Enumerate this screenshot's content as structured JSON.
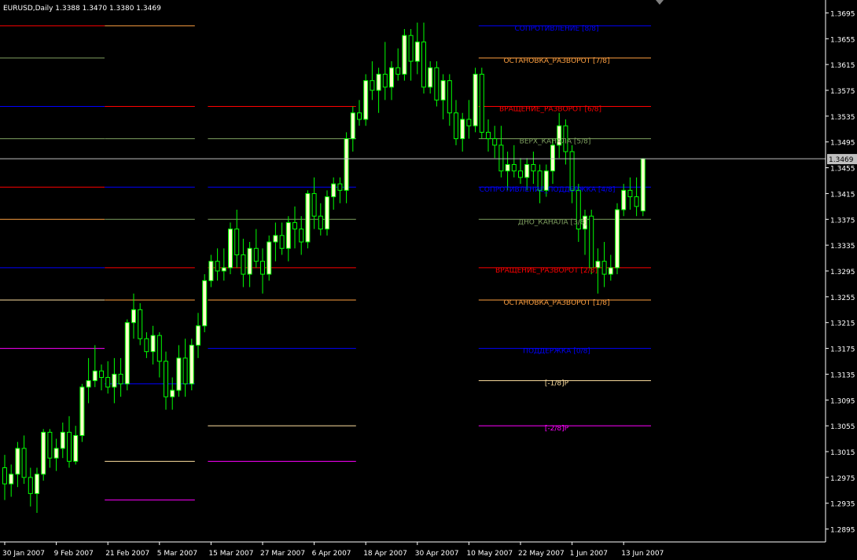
{
  "window": {
    "symbol_line": "EURUSD,Daily  1.3388 1.3470 1.3380 1.3469"
  },
  "colors": {
    "background": "#000000",
    "grid": "#606060",
    "axis_text": "#ffffff",
    "bull_body": "#ffffcc",
    "candle_outline": "#00ff00",
    "bear_body": "#000000",
    "current_price_line": "#c0c0c0"
  },
  "chart_data": {
    "type": "candlestick",
    "instrument": "EURUSD",
    "timeframe": "Daily",
    "ylim": [
      1.2875,
      1.3715
    ],
    "y_ticks": [
      "1.3695",
      "1.3655",
      "1.3615",
      "1.3575",
      "1.3535",
      "1.3495",
      "1.3455",
      "1.3415",
      "1.3375",
      "1.3335",
      "1.3295",
      "1.3255",
      "1.3215",
      "1.3175",
      "1.3135",
      "1.3095",
      "1.3055",
      "1.3015",
      "1.2975",
      "1.2935",
      "1.2895"
    ],
    "x_ticks": [
      {
        "label": "30 Jan 2007",
        "bar": 0
      },
      {
        "label": "9 Feb 2007",
        "bar": 8
      },
      {
        "label": "21 Feb 2007",
        "bar": 16
      },
      {
        "label": "5 Mar 2007",
        "bar": 24
      },
      {
        "label": "15 Mar 2007",
        "bar": 32
      },
      {
        "label": "27 Mar 2007",
        "bar": 40
      },
      {
        "label": "6 Apr 2007",
        "bar": 48
      },
      {
        "label": "18 Apr 2007",
        "bar": 56
      },
      {
        "label": "30 Apr 2007",
        "bar": 64
      },
      {
        "label": "10 May 2007",
        "bar": 72
      },
      {
        "label": "22 May 2007",
        "bar": 80
      },
      {
        "label": "1 Jun 2007",
        "bar": 88
      },
      {
        "label": "13 Jun 2007",
        "bar": 96
      }
    ],
    "current_price": "1.3469",
    "ohlc": [
      [
        1.299,
        1.301,
        1.294,
        1.2965
      ],
      [
        1.2965,
        1.2995,
        1.2945,
        1.298
      ],
      [
        1.298,
        1.303,
        1.296,
        1.302
      ],
      [
        1.302,
        1.304,
        1.2965,
        1.2975
      ],
      [
        1.2975,
        1.299,
        1.293,
        1.295
      ],
      [
        1.295,
        1.299,
        1.292,
        1.298
      ],
      [
        1.298,
        1.305,
        1.297,
        1.3045
      ],
      [
        1.3045,
        1.305,
        1.299,
        1.3005
      ],
      [
        1.3005,
        1.3035,
        1.2985,
        1.302
      ],
      [
        1.302,
        1.306,
        1.3005,
        1.3045
      ],
      [
        1.3045,
        1.307,
        1.299,
        1.3
      ],
      [
        1.3,
        1.3055,
        1.2995,
        1.304
      ],
      [
        1.304,
        1.312,
        1.303,
        1.3115
      ],
      [
        1.3115,
        1.316,
        1.309,
        1.3125
      ],
      [
        1.3125,
        1.318,
        1.3115,
        1.314
      ],
      [
        1.314,
        1.315,
        1.311,
        1.313
      ],
      [
        1.313,
        1.3155,
        1.3105,
        1.3115
      ],
      [
        1.3115,
        1.316,
        1.309,
        1.3135
      ],
      [
        1.3135,
        1.316,
        1.31,
        1.312
      ],
      [
        1.312,
        1.322,
        1.311,
        1.3215
      ],
      [
        1.3215,
        1.326,
        1.319,
        1.3235
      ],
      [
        1.3235,
        1.3245,
        1.318,
        1.319
      ],
      [
        1.319,
        1.32,
        1.316,
        1.317
      ],
      [
        1.317,
        1.321,
        1.315,
        1.3195
      ],
      [
        1.3195,
        1.32,
        1.313,
        1.3155
      ],
      [
        1.3155,
        1.317,
        1.308,
        1.31
      ],
      [
        1.31,
        1.313,
        1.308,
        1.311
      ],
      [
        1.311,
        1.318,
        1.31,
        1.316
      ],
      [
        1.316,
        1.319,
        1.31,
        1.312
      ],
      [
        1.312,
        1.319,
        1.311,
        1.318
      ],
      [
        1.318,
        1.323,
        1.316,
        1.321
      ],
      [
        1.321,
        1.329,
        1.32,
        1.328
      ],
      [
        1.328,
        1.332,
        1.327,
        1.331
      ],
      [
        1.331,
        1.333,
        1.328,
        1.3295
      ],
      [
        1.3295,
        1.333,
        1.328,
        1.33
      ],
      [
        1.33,
        1.337,
        1.329,
        1.336
      ],
      [
        1.336,
        1.339,
        1.33,
        1.332
      ],
      [
        1.332,
        1.3345,
        1.327,
        1.329
      ],
      [
        1.329,
        1.334,
        1.327,
        1.333
      ],
      [
        1.333,
        1.336,
        1.33,
        1.331
      ],
      [
        1.331,
        1.333,
        1.326,
        1.329
      ],
      [
        1.329,
        1.335,
        1.328,
        1.334
      ],
      [
        1.334,
        1.337,
        1.331,
        1.335
      ],
      [
        1.335,
        1.337,
        1.332,
        1.333
      ],
      [
        1.333,
        1.338,
        1.331,
        1.337
      ],
      [
        1.337,
        1.3395,
        1.333,
        1.336
      ],
      [
        1.336,
        1.338,
        1.332,
        1.334
      ],
      [
        1.334,
        1.342,
        1.333,
        1.3415
      ],
      [
        1.3415,
        1.344,
        1.336,
        1.338
      ],
      [
        1.338,
        1.34,
        1.335,
        1.336
      ],
      [
        1.336,
        1.342,
        1.335,
        1.341
      ],
      [
        1.341,
        1.344,
        1.339,
        1.343
      ],
      [
        1.343,
        1.344,
        1.34,
        1.342
      ],
      [
        1.342,
        1.351,
        1.34,
        1.35
      ],
      [
        1.35,
        1.355,
        1.348,
        1.354
      ],
      [
        1.354,
        1.356,
        1.352,
        1.353
      ],
      [
        1.353,
        1.36,
        1.352,
        1.359
      ],
      [
        1.359,
        1.362,
        1.356,
        1.3575
      ],
      [
        1.3575,
        1.361,
        1.354,
        1.36
      ],
      [
        1.36,
        1.365,
        1.356,
        1.358
      ],
      [
        1.358,
        1.362,
        1.356,
        1.361
      ],
      [
        1.361,
        1.364,
        1.359,
        1.36
      ],
      [
        1.36,
        1.367,
        1.359,
        1.366
      ],
      [
        1.366,
        1.367,
        1.359,
        1.362
      ],
      [
        1.362,
        1.368,
        1.36,
        1.365
      ],
      [
        1.365,
        1.368,
        1.357,
        1.358
      ],
      [
        1.358,
        1.362,
        1.357,
        1.361
      ],
      [
        1.361,
        1.362,
        1.355,
        1.356
      ],
      [
        1.356,
        1.36,
        1.353,
        1.359
      ],
      [
        1.359,
        1.36,
        1.352,
        1.354
      ],
      [
        1.354,
        1.356,
        1.349,
        1.35
      ],
      [
        1.35,
        1.354,
        1.348,
        1.353
      ],
      [
        1.353,
        1.356,
        1.35,
        1.352
      ],
      [
        1.352,
        1.361,
        1.351,
        1.36
      ],
      [
        1.36,
        1.361,
        1.35,
        1.351
      ],
      [
        1.351,
        1.353,
        1.348,
        1.35
      ],
      [
        1.35,
        1.352,
        1.347,
        1.349
      ],
      [
        1.349,
        1.352,
        1.344,
        1.345
      ],
      [
        1.345,
        1.348,
        1.342,
        1.346
      ],
      [
        1.346,
        1.349,
        1.344,
        1.345
      ],
      [
        1.345,
        1.347,
        1.343,
        1.344
      ],
      [
        1.344,
        1.347,
        1.342,
        1.346
      ],
      [
        1.346,
        1.348,
        1.343,
        1.345
      ],
      [
        1.345,
        1.346,
        1.34,
        1.342
      ],
      [
        1.342,
        1.346,
        1.341,
        1.345
      ],
      [
        1.345,
        1.35,
        1.343,
        1.349
      ],
      [
        1.349,
        1.354,
        1.347,
        1.352
      ],
      [
        1.352,
        1.353,
        1.346,
        1.348
      ],
      [
        1.348,
        1.349,
        1.34,
        1.342
      ],
      [
        1.342,
        1.343,
        1.334,
        1.336
      ],
      [
        1.336,
        1.339,
        1.332,
        1.338
      ],
      [
        1.338,
        1.339,
        1.329,
        1.33
      ],
      [
        1.33,
        1.333,
        1.326,
        1.331
      ],
      [
        1.331,
        1.334,
        1.327,
        1.329
      ],
      [
        1.329,
        1.332,
        1.328,
        1.33
      ],
      [
        1.33,
        1.34,
        1.329,
        1.339
      ],
      [
        1.339,
        1.343,
        1.338,
        1.342
      ],
      [
        1.342,
        1.344,
        1.339,
        1.341
      ],
      [
        1.341,
        1.344,
        1.338,
        1.3395
      ],
      [
        1.3388,
        1.347,
        1.338,
        1.3469
      ]
    ],
    "murrey_levels": [
      {
        "label": "СОПРОТИВЛЕНИЕ [8/8]",
        "price": 1.3675,
        "color": "#0000ff"
      },
      {
        "label": "ОСТАНОВКА_РАЗВОРОТ [7/8]",
        "price": 1.3625,
        "color": "#ffa040"
      },
      {
        "label": "ВРАЩЕНИЕ_РАЗВОРОТ [6/8]",
        "price": 1.355,
        "color": "#ff0000"
      },
      {
        "label": "ВЕРХ_КАНАЛА [5/8]",
        "price": 1.35,
        "color": "#7fa060"
      },
      {
        "label": "СОПРОТИВЛЕНИЕ_ПОДДЕРЖКА [4/8]",
        "price": 1.3425,
        "color": "#0000ff"
      },
      {
        "label": "ДНО_КАНАЛА [3/8]",
        "price": 1.3375,
        "color": "#7fa060"
      },
      {
        "label": "ВРАЩЕНИЕ_РАЗВОРОТ [2/8]",
        "price": 1.33,
        "color": "#ff0000"
      },
      {
        "label": "ОСТАНОВКА_РАЗВОРОТ [1/8]",
        "price": 1.325,
        "color": "#ffa040"
      },
      {
        "label": "ПОДДЕРЖКА [0/8]",
        "price": 1.3175,
        "color": "#0000ff"
      },
      {
        "label": "[-1/8]P",
        "price": 1.3125,
        "color": "#ffe0a0"
      },
      {
        "label": "[-2/8]P",
        "price": 1.3055,
        "color": "#ff00ff"
      }
    ],
    "murrey_history": {
      "segments": [
        {
          "from": 0,
          "to": 15,
          "levels": [
            1.378,
            1.3725,
            1.3675,
            1.3625,
            1.355,
            1.35,
            1.3425,
            1.3375,
            1.33,
            1.325,
            1.3175
          ]
        },
        {
          "from": 16,
          "to": 29,
          "levels": [
            1.372,
            1.3675,
            1.355,
            1.35,
            1.3425,
            1.3375,
            1.33,
            1.325,
            1.312,
            1.3,
            1.294
          ]
        },
        {
          "from": 32,
          "to": 54,
          "levels": [
            1.378,
            1.3725,
            1.355,
            1.35,
            1.3425,
            1.3375,
            1.33,
            1.325,
            1.3175,
            1.3055,
            1.3
          ]
        },
        {
          "from": 74,
          "to": 102,
          "levels": [
            1.3675,
            1.3625,
            1.355,
            1.35,
            1.3425,
            1.3375,
            1.33,
            1.325,
            1.3175,
            1.3125,
            1.3055
          ]
        }
      ]
    },
    "grid": false
  }
}
